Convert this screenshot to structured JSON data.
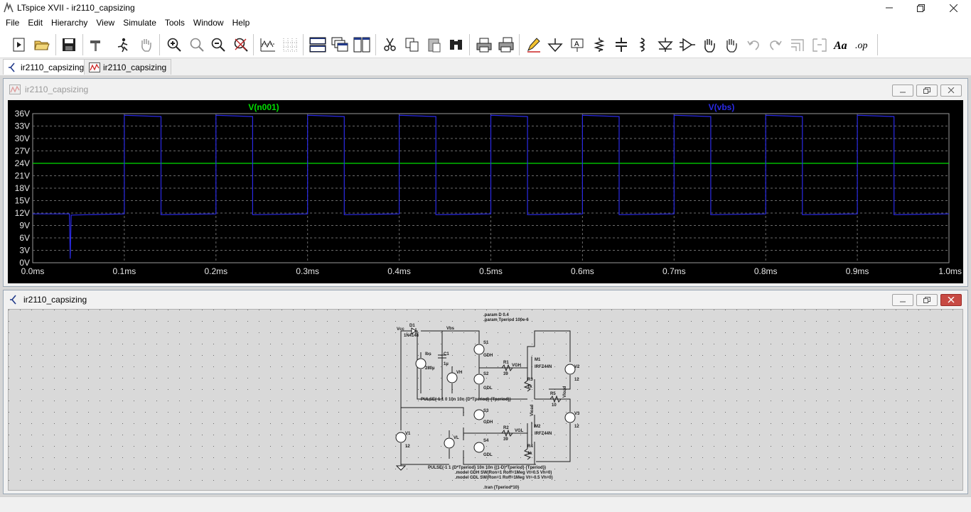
{
  "window": {
    "title": "LTspice XVII - ir2110_capsizing"
  },
  "menu": [
    "File",
    "Edit",
    "Hierarchy",
    "View",
    "Simulate",
    "Tools",
    "Window",
    "Help"
  ],
  "toolbar_icons": [
    "run",
    "open",
    "save",
    "control-panel",
    "halt",
    "pan",
    "zoom-in",
    "zoom-area",
    "zoom-out",
    "zoom-fit",
    "autorange",
    "grid",
    "tile-horizontal",
    "cascade",
    "tile-vertical",
    "cut",
    "copy",
    "paste",
    "find",
    "print",
    "print-preview",
    "draw-wire",
    "ground",
    "label-net",
    "resistor",
    "capacitor",
    "inductor",
    "diode",
    "component",
    "move",
    "drag",
    "undo",
    "redo",
    "rotate",
    "mirror",
    "text",
    "spice-directive"
  ],
  "tabs": [
    {
      "label": "ir2110_capsizing",
      "kind": "schematic"
    },
    {
      "label": "ir2110_capsizing",
      "kind": "waveform"
    }
  ],
  "plot_window": {
    "title": "ir2110_capsizing"
  },
  "schematic_window": {
    "title": "ir2110_capsizing"
  },
  "chart_data": {
    "type": "line",
    "x_unit": "ms",
    "xlim": [
      0,
      1.0
    ],
    "ylim": [
      0,
      36
    ],
    "x_ticks": [
      "0.0ms",
      "0.1ms",
      "0.2ms",
      "0.3ms",
      "0.4ms",
      "0.5ms",
      "0.6ms",
      "0.7ms",
      "0.8ms",
      "0.9ms",
      "1.0ms"
    ],
    "y_ticks": [
      "0V",
      "3V",
      "6V",
      "9V",
      "12V",
      "15V",
      "18V",
      "21V",
      "24V",
      "27V",
      "30V",
      "33V",
      "36V"
    ],
    "grid": true,
    "series": [
      {
        "name": "V(n001)",
        "color": "#00e000",
        "x": [
          0,
          1.0
        ],
        "y": [
          24,
          24
        ]
      },
      {
        "name": "V(vbs)",
        "color": "#2a2ae6",
        "x": [
          0,
          0.04,
          0.041,
          0.042,
          0.06,
          0.1,
          0.1,
          0.14,
          0.14,
          0.2,
          0.2,
          0.24,
          0.24,
          0.3,
          0.3,
          0.34,
          0.34,
          0.4,
          0.4,
          0.44,
          0.44,
          0.5,
          0.5,
          0.54,
          0.54,
          0.6,
          0.6,
          0.64,
          0.64,
          0.7,
          0.7,
          0.74,
          0.74,
          0.8,
          0.8,
          0.84,
          0.84,
          0.9,
          0.9,
          0.94,
          0.94,
          1.0
        ],
        "y": [
          11.8,
          11.8,
          1.0,
          11.5,
          11.6,
          11.8,
          35.6,
          35.3,
          11.6,
          11.8,
          35.6,
          35.3,
          11.6,
          11.8,
          35.6,
          35.3,
          11.6,
          11.8,
          35.6,
          35.3,
          11.6,
          11.8,
          35.6,
          35.3,
          11.6,
          11.8,
          35.6,
          35.3,
          11.6,
          11.8,
          35.6,
          35.3,
          11.6,
          11.8,
          35.6,
          35.3,
          11.6,
          11.8,
          35.6,
          35.3,
          11.6,
          11.8
        ]
      }
    ]
  },
  "schematic": {
    "directives_top": [
      ".param D 0.4",
      ".param Tperiod 100e-6"
    ],
    "labels": {
      "vcc": "Vcc",
      "d1": "D1",
      "d1_model": "1N4148",
      "vbs": "Vbs",
      "c1": "C1",
      "c1_val": "1µ",
      "ibs": "Ibs",
      "ibs_val": "280µ",
      "s1": "S1",
      "s2": "S2",
      "s3": "S3",
      "s4": "S4",
      "gdh": "GDH",
      "gdl": "GDL",
      "vh": "VH",
      "vl": "VL",
      "r1": "R1",
      "r1_val": "39",
      "vgh": "VGH",
      "vgl": "VGL",
      "r2": "R2",
      "r2_val": "39",
      "r3": "R3",
      "r3_val": "1k",
      "r4": "R4",
      "r4_val": "1k",
      "m1": "M1",
      "m1_model": "IRFZ44N",
      "m2": "M2",
      "m2_model": "IRFZ44N",
      "v2": "V2",
      "v2_val": "12",
      "v3": "V3",
      "v3_val": "12",
      "v1": "V1",
      "v1_val": "12",
      "r5": "R5",
      "r5_val": "10",
      "vload": "Vload",
      "vload2": "Vload"
    },
    "pulse_high": "PULSE(-1 1 0 10n 10n {D*Tperiod} {Tperiod})",
    "pulse_low": "PULSE(-1 1 {D*Tperiod} 10n 10n {(1-D)*Tperiod} {Tperiod})",
    "model_gdh": ".model GDH SW(Ron=1 Roff=1Meg Vt=0.5 Vh=0)",
    "model_gdl": ".model GDL SW(Ron=1 Roff=1Meg Vt=-0.5 Vh=0)",
    "tran": ".tran {Tperiod*10}"
  }
}
